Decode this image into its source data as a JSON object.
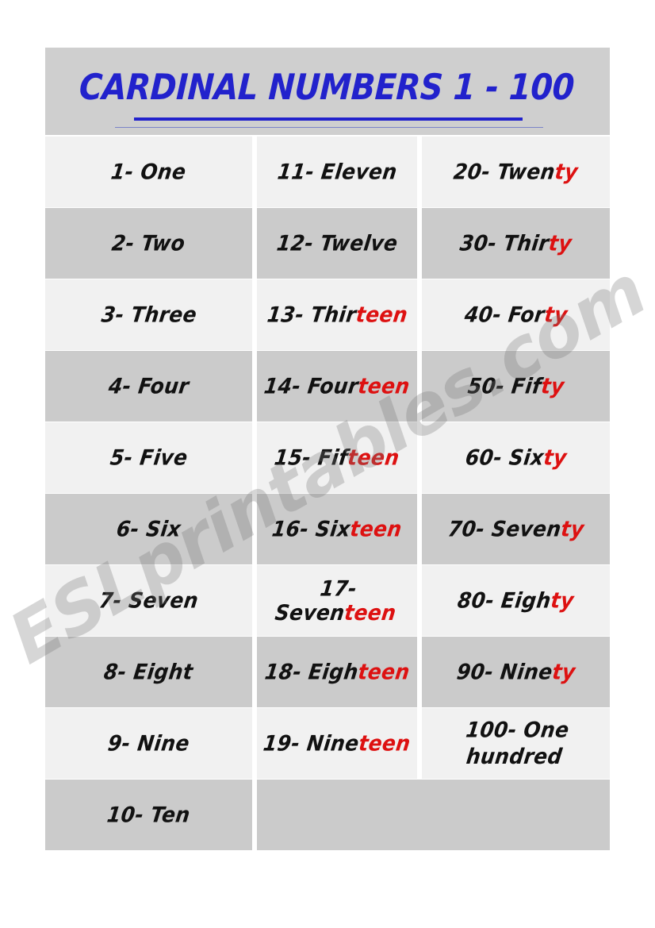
{
  "page": {
    "background": "#ffffff",
    "sheet_background": "#cfcfcf"
  },
  "header": {
    "title": "CARDINAL NUMBERS 1 - 100",
    "title_color": "#2222cc",
    "band_color": "#cfcfcf",
    "rule_thick_color": "#2222cc",
    "rule_thin_color": "#7b84c8"
  },
  "colors": {
    "row_light": "#f1f1f1",
    "row_dark": "#cbcbcb",
    "text_black": "#111111",
    "text_red": "#dd1111"
  },
  "watermark": {
    "text": "ESLprintables.com",
    "color": "rgba(120,120,120,0.30)",
    "rotation_deg": -30
  },
  "table": {
    "columns": 3,
    "rows": [
      {
        "shade": "light",
        "cells": [
          {
            "number": "1",
            "word_black": "One",
            "word_red": "",
            "text": "1- One"
          },
          {
            "number": "11",
            "word_black": "Eleven",
            "word_red": "",
            "text": "11- Eleven"
          },
          {
            "number": "20",
            "word_black": "Twen",
            "word_red": "ty",
            "text": "20- Twenty"
          }
        ]
      },
      {
        "shade": "dark",
        "cells": [
          {
            "number": "2",
            "word_black": "Two",
            "word_red": "",
            "text": "2- Two"
          },
          {
            "number": "12",
            "word_black": "Twelve",
            "word_red": "",
            "text": "12- Twelve"
          },
          {
            "number": "30",
            "word_black": "Thir",
            "word_red": "ty",
            "text": "30- Thirty"
          }
        ]
      },
      {
        "shade": "light",
        "cells": [
          {
            "number": "3",
            "word_black": "Three",
            "word_red": "",
            "text": "3- Three"
          },
          {
            "number": "13",
            "word_black": "Thir",
            "word_red": "teen",
            "text": "13- Thirteen"
          },
          {
            "number": "40",
            "word_black": "For",
            "word_red": "ty",
            "text": "40- Forty"
          }
        ]
      },
      {
        "shade": "dark",
        "cells": [
          {
            "number": "4",
            "word_black": "Four",
            "word_red": "",
            "text": "4- Four"
          },
          {
            "number": "14",
            "word_black": "Four",
            "word_red": "teen",
            "text": "14- Fourteen"
          },
          {
            "number": "50",
            "word_black": "Fif",
            "word_red": "ty",
            "text": "50- Fifty"
          }
        ]
      },
      {
        "shade": "light",
        "cells": [
          {
            "number": "5",
            "word_black": "Five",
            "word_red": "",
            "text": "5- Five"
          },
          {
            "number": "15",
            "word_black": "Fif",
            "word_red": "teen",
            "text": "15- Fifteen"
          },
          {
            "number": "60",
            "word_black": "Six",
            "word_red": "ty",
            "text": "60- Sixty"
          }
        ]
      },
      {
        "shade": "dark",
        "cells": [
          {
            "number": "6",
            "word_black": "Six",
            "word_red": "",
            "text": "6- Six"
          },
          {
            "number": "16",
            "word_black": "Six",
            "word_red": "teen",
            "text": "16- Sixteen"
          },
          {
            "number": "70",
            "word_black": "Seven",
            "word_red": "ty",
            "text": "70- Seventy"
          }
        ]
      },
      {
        "shade": "light",
        "cells": [
          {
            "number": "7",
            "word_black": "Seven",
            "word_red": "",
            "text": "7- Seven"
          },
          {
            "number": "17",
            "word_black": "Seven",
            "word_red": "teen",
            "text": "17- Seventeen"
          },
          {
            "number": "80",
            "word_black": "Eigh",
            "word_red": "ty",
            "text": "80- Eighty"
          }
        ]
      },
      {
        "shade": "dark",
        "cells": [
          {
            "number": "8",
            "word_black": "Eight",
            "word_red": "",
            "text": "8- Eight"
          },
          {
            "number": "18",
            "word_black": "Eigh",
            "word_red": "teen",
            "text": "18- Eighteen"
          },
          {
            "number": "90",
            "word_black": "Nine",
            "word_red": "ty",
            "text": "90- Ninety"
          }
        ]
      },
      {
        "shade": "light",
        "cells": [
          {
            "number": "9",
            "word_black": "Nine",
            "word_red": "",
            "text": "9- Nine"
          },
          {
            "number": "19",
            "word_black": "Nine",
            "word_red": "teen",
            "text": "19- Nineteen"
          },
          {
            "number": "100",
            "word_black": "One hundred",
            "word_red": "",
            "text": "100- One hundred"
          }
        ]
      },
      {
        "shade": "dark",
        "cells": [
          {
            "number": "10",
            "word_black": "Ten",
            "word_red": "",
            "text": "10- Ten"
          },
          {
            "number": "",
            "word_black": "",
            "word_red": "",
            "text": ""
          }
        ]
      }
    ]
  }
}
